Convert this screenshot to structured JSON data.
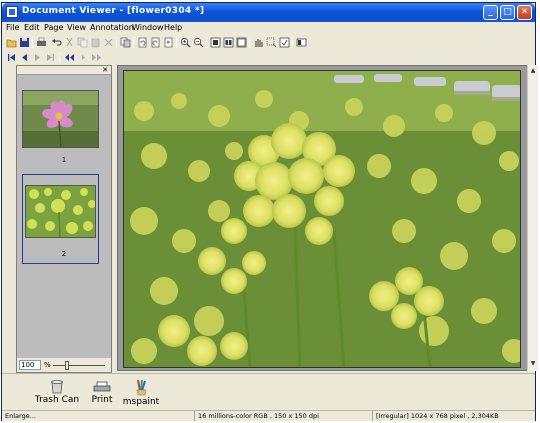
{
  "window": {
    "title": "Document Viewer - [flower0304 *]",
    "controls": {
      "minimize": "_",
      "maximize": "□",
      "close": "✕"
    }
  },
  "menu": [
    {
      "label": "File"
    },
    {
      "label": "Edit"
    },
    {
      "label": "Page"
    },
    {
      "label": "View"
    },
    {
      "label": "Annotation"
    },
    {
      "label": "Window"
    },
    {
      "label": "Help"
    }
  ],
  "toolbar_icons": [
    "open-folder-icon",
    "save-icon",
    "print-icon",
    "undo-icon",
    "cut-icon",
    "copy-icon",
    "paste-icon",
    "delete-icon",
    "clipboard-image-icon",
    "rotate-left-icon",
    "rotate-right-icon",
    "flip-icon",
    "zoom-in-icon",
    "zoom-out-icon",
    "single-page-icon",
    "two-page-icon",
    "full-screen-icon",
    "pan-hand-icon",
    "select-area-icon",
    "fit-icon",
    "thumbnail-toggle-icon"
  ],
  "nav_icons": [
    "first-page-icon",
    "prev-page-icon",
    "next-page-icon",
    "last-page-icon",
    "page-back-icon",
    "page-forward-icon",
    "page-end-icon"
  ],
  "thumbnails": [
    {
      "number": "1"
    },
    {
      "number": "2"
    }
  ],
  "zoom": {
    "value": "100",
    "unit": "%"
  },
  "shortcuts": [
    {
      "label": "Trash Can",
      "icon": "trash-can-icon"
    },
    {
      "label": "Print",
      "icon": "printer-icon"
    },
    {
      "label": "mspaint",
      "icon": "paint-brushes-icon"
    }
  ],
  "status": {
    "left": "Enlarge...",
    "color_info": "16 millions-color RGB ,  150 x 150 dpi",
    "size_info": "[Irregular]  1024 x 768 pixel , 2,304KB"
  },
  "colors": {
    "title_blue": "#0c55d8",
    "chrome": "#ece9d8",
    "flower_yellow": "#e4e66a",
    "foliage_green": "#6e9a3a"
  }
}
